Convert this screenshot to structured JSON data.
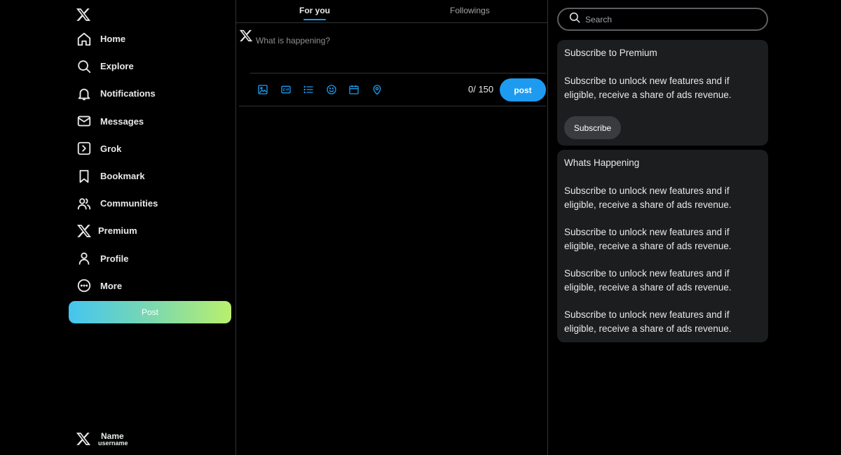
{
  "sidebar": {
    "nav": [
      {
        "label": "Home",
        "icon": "home-icon"
      },
      {
        "label": "Explore",
        "icon": "search-icon"
      },
      {
        "label": "Notifications",
        "icon": "bell-icon"
      },
      {
        "label": "Messages",
        "icon": "mail-icon"
      },
      {
        "label": "Grok",
        "icon": "grok-icon"
      },
      {
        "label": "Bookmark",
        "icon": "bookmark-icon"
      },
      {
        "label": "Communities",
        "icon": "users-icon"
      },
      {
        "label": "Premium",
        "icon": "x-logo-icon"
      },
      {
        "label": "Profile",
        "icon": "user-icon"
      },
      {
        "label": "More",
        "icon": "more-circle-icon"
      }
    ],
    "post_label": "Post",
    "profile": {
      "name": "Name",
      "username": "username"
    }
  },
  "tabs": [
    {
      "label": "For you",
      "active": true
    },
    {
      "label": "Followings",
      "active": false
    }
  ],
  "compose": {
    "placeholder": "What is happening?",
    "value": "",
    "char_count": "0/ 150",
    "post_label": "post",
    "tools": [
      "image-icon",
      "gif-icon",
      "list-icon",
      "emoji-icon",
      "schedule-icon",
      "location-icon"
    ]
  },
  "search": {
    "placeholder": "Search"
  },
  "premium_card": {
    "title": "Subscribe to Premium",
    "body": "Subscribe to unlock new features and if eligible, receive a share of ads revenue.",
    "button_label": "Subscribe"
  },
  "happening_card": {
    "title": "Whats Happening",
    "items": [
      "Subscribe to unlock new features and if eligible, receive a share of ads revenue.",
      "Subscribe to unlock new features and if eligible, receive a share of ads revenue.",
      "Subscribe to unlock new features and if eligible, receive a share of ads revenue.",
      "Subscribe to unlock new features and if eligible, receive a share of ads revenue."
    ]
  },
  "colors": {
    "background": "#000000",
    "accent": "#1d9bf0",
    "card": "#1c1d1f",
    "border": "#2f3336",
    "gradient_start": "#44c5f0",
    "gradient_end": "#b9ef6e"
  }
}
